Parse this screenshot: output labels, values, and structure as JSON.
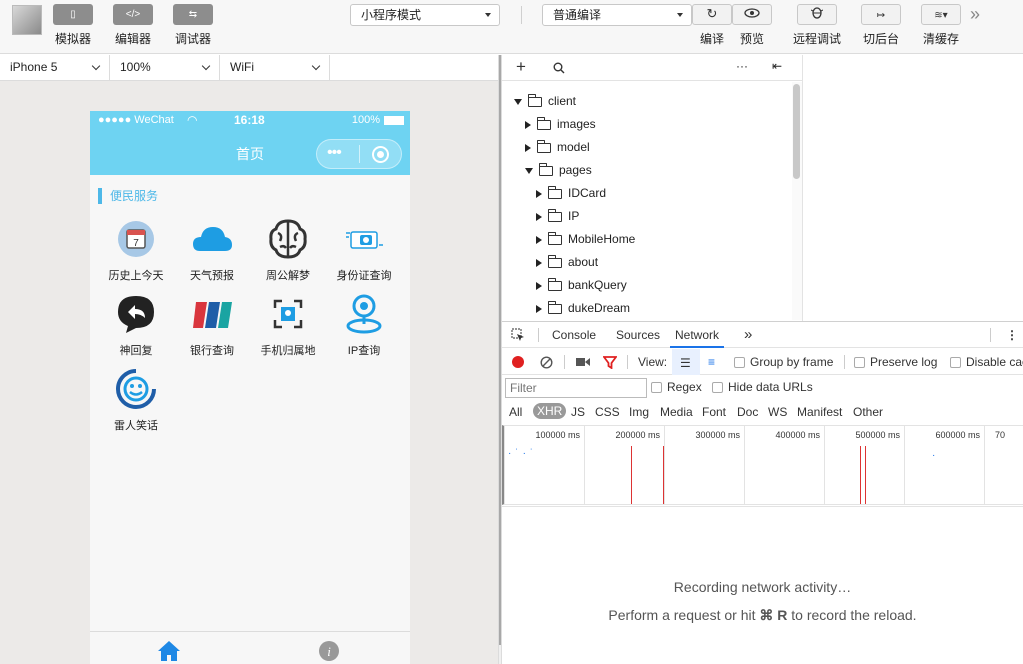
{
  "toolbar": {
    "simulator_label": "模拟器",
    "editor_label": "编辑器",
    "debugger_label": "调试器",
    "mode_select": "小程序模式",
    "compile_select": "普通编译",
    "compile_label": "编译",
    "preview_label": "预览",
    "remote_debug_label": "远程调试",
    "background_label": "切后台",
    "clear_cache_label": "清缓存",
    "more_label": "»",
    "editor_btn_glyph": "</>"
  },
  "device_bar": {
    "device": "iPhone 5",
    "zoom": "100%",
    "network": "WiFi"
  },
  "phone": {
    "signal": "●●●●● WeChat",
    "time": "16:18",
    "battery": "100%",
    "nav_title": "首页",
    "section_title": "便民服务",
    "items": [
      {
        "label": "历史上今天",
        "icon": "history-calendar-icon"
      },
      {
        "label": "天气预报",
        "icon": "cloud-icon"
      },
      {
        "label": "周公解梦",
        "icon": "brain-icon"
      },
      {
        "label": "身份证查询",
        "icon": "id-card-icon"
      },
      {
        "label": "神回复",
        "icon": "reply-bubble-icon"
      },
      {
        "label": "银行查询",
        "icon": "bank-card-icon"
      },
      {
        "label": "手机归属地",
        "icon": "phone-location-icon"
      },
      {
        "label": "IP查询",
        "icon": "location-pin-icon"
      },
      {
        "label": "雷人笑话",
        "icon": "smiley-icon"
      }
    ],
    "tabs": [
      {
        "icon": "home-icon"
      },
      {
        "icon": "info-icon"
      }
    ]
  },
  "file_tree": {
    "rows": [
      {
        "label": "client",
        "depth": 0,
        "expanded": true
      },
      {
        "label": "images",
        "depth": 1,
        "expanded": false
      },
      {
        "label": "model",
        "depth": 1,
        "expanded": false
      },
      {
        "label": "pages",
        "depth": 1,
        "expanded": true
      },
      {
        "label": "IDCard",
        "depth": 2,
        "expanded": false
      },
      {
        "label": "IP",
        "depth": 2,
        "expanded": false
      },
      {
        "label": "MobileHome",
        "depth": 2,
        "expanded": false
      },
      {
        "label": "about",
        "depth": 2,
        "expanded": false
      },
      {
        "label": "bankQuery",
        "depth": 2,
        "expanded": false
      },
      {
        "label": "dukeDream",
        "depth": 2,
        "expanded": false
      }
    ],
    "more": "···"
  },
  "devtools": {
    "tabs": [
      "Console",
      "Sources",
      "Network"
    ],
    "active_tab": "Network",
    "more": "»",
    "view_label": "View:",
    "group_by_frame": "Group by frame",
    "preserve_log": "Preserve log",
    "disable_cache": "Disable cache",
    "filter_placeholder": "Filter",
    "regex": "Regex",
    "hide_data_urls": "Hide data URLs",
    "filter_types": [
      "All",
      "XHR",
      "JS",
      "CSS",
      "Img",
      "Media",
      "Font",
      "Doc",
      "WS",
      "Manifest",
      "Other"
    ],
    "active_filter": "XHR",
    "ticks": [
      "100000 ms",
      "200000 ms",
      "300000 ms",
      "400000 ms",
      "500000 ms",
      "600000 ms",
      "70"
    ],
    "empty_title": "Recording network activity…",
    "empty_hint_prefix": "Perform a request or hit ",
    "empty_hint_key": "⌘ R",
    "empty_hint_suffix": " to record the reload."
  },
  "colors": {
    "nav_bg": "#6ed3f2",
    "accent_blue": "#1a73e8",
    "record_red": "#e02020"
  }
}
